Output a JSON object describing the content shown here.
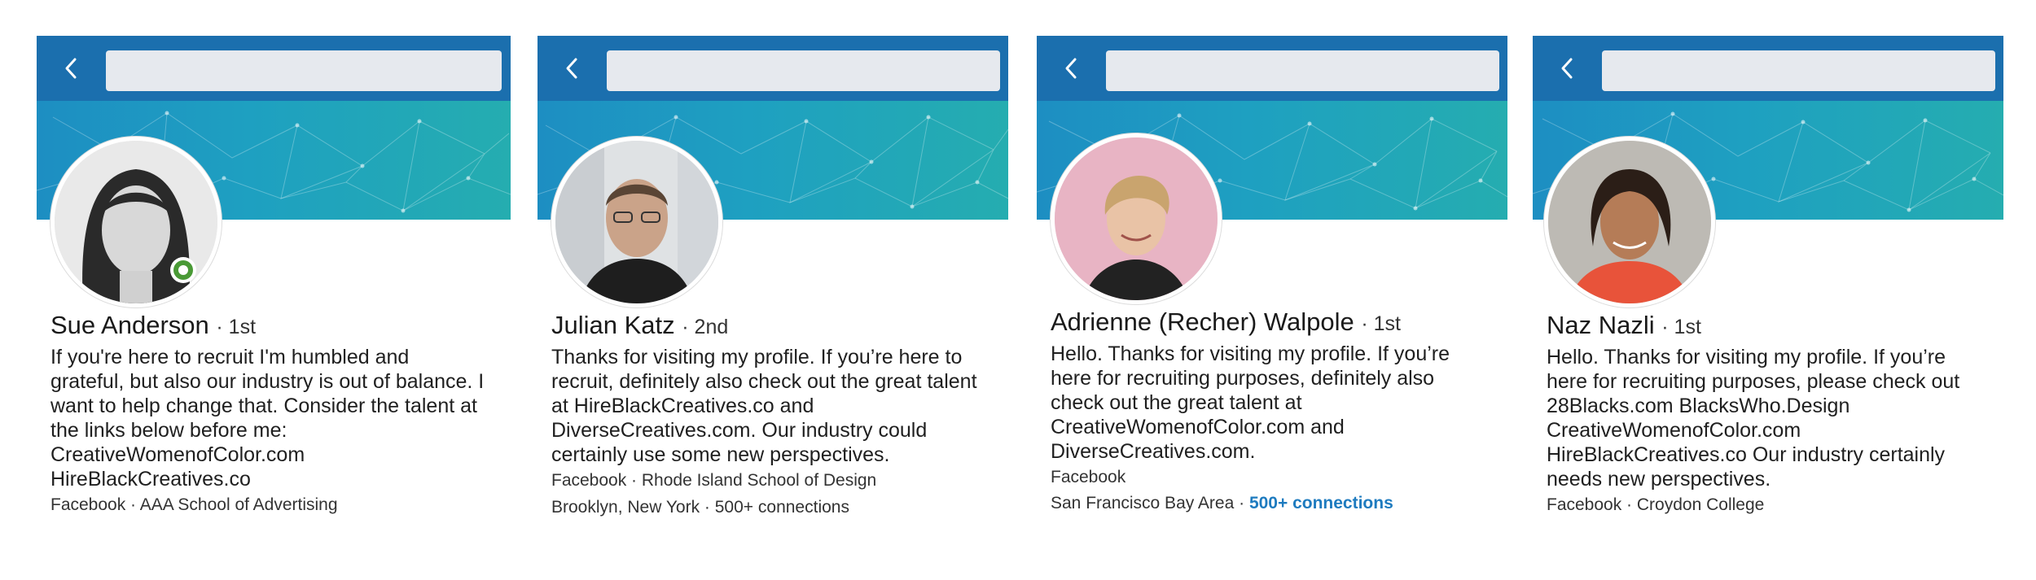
{
  "colors": {
    "topbar": "#1b6fae",
    "banner_start": "#1d8ec2",
    "banner_end": "#25adb0",
    "search_bg": "#e6e9ee",
    "online_green": "#4a9a36",
    "link_blue": "#1e7bbf"
  },
  "profiles": [
    {
      "name": "Sue Anderson",
      "degree": "· 1st",
      "online": true,
      "bio": "If you're here to recruit I'm humbled and\ngrateful, but also our industry is out of balance. I\nwant to help change that. Consider the talent at\nthe links below before me:\nCreativeWomenofColor.com\nHireBlackCreatives.co",
      "meta_line1": "Facebook · AAA School of Advertising",
      "icons": {
        "back": "chevron-left-icon",
        "avatar": "profile-photo"
      }
    },
    {
      "name": "Julian Katz",
      "degree": "· 2nd",
      "online": false,
      "bio": "Thanks for visiting my profile. If you’re here to\nrecruit, definitely also check out the great talent\nat HireBlackCreatives.co and\nDiverseCreatives.com. Our industry could\ncertainly use some new perspectives.",
      "meta_line1": "Facebook · Rhode Island School of Design",
      "meta_line2": "Brooklyn, New York · 500+ connections",
      "icons": {
        "back": "chevron-left-icon",
        "avatar": "profile-photo"
      }
    },
    {
      "name": "Adrienne (Recher) Walpole",
      "degree": "· 1st",
      "online": false,
      "bio": "Hello. Thanks for visiting my profile. If you’re\nhere for recruiting purposes, definitely also\ncheck out the great talent at\nCreativeWomenofColor.com and\nDiverseCreatives.com.",
      "meta_line1": "Facebook",
      "meta_line2_location": "San Francisco Bay Area ·",
      "meta_line2_link": "500+ connections",
      "icons": {
        "back": "chevron-left-icon",
        "avatar": "profile-photo"
      }
    },
    {
      "name": "Naz Nazli",
      "degree": "· 1st",
      "online": false,
      "bio": "Hello. Thanks for visiting my profile. If you’re\nhere for recruiting purposes, please check out\n28Blacks.com BlacksWho.Design\nCreativeWomenofColor.com\nHireBlackCreatives.co Our industry certainly\nneeds new perspectives.",
      "meta_line1": "Facebook · Croydon College",
      "icons": {
        "back": "chevron-left-icon",
        "avatar": "profile-photo"
      }
    }
  ]
}
